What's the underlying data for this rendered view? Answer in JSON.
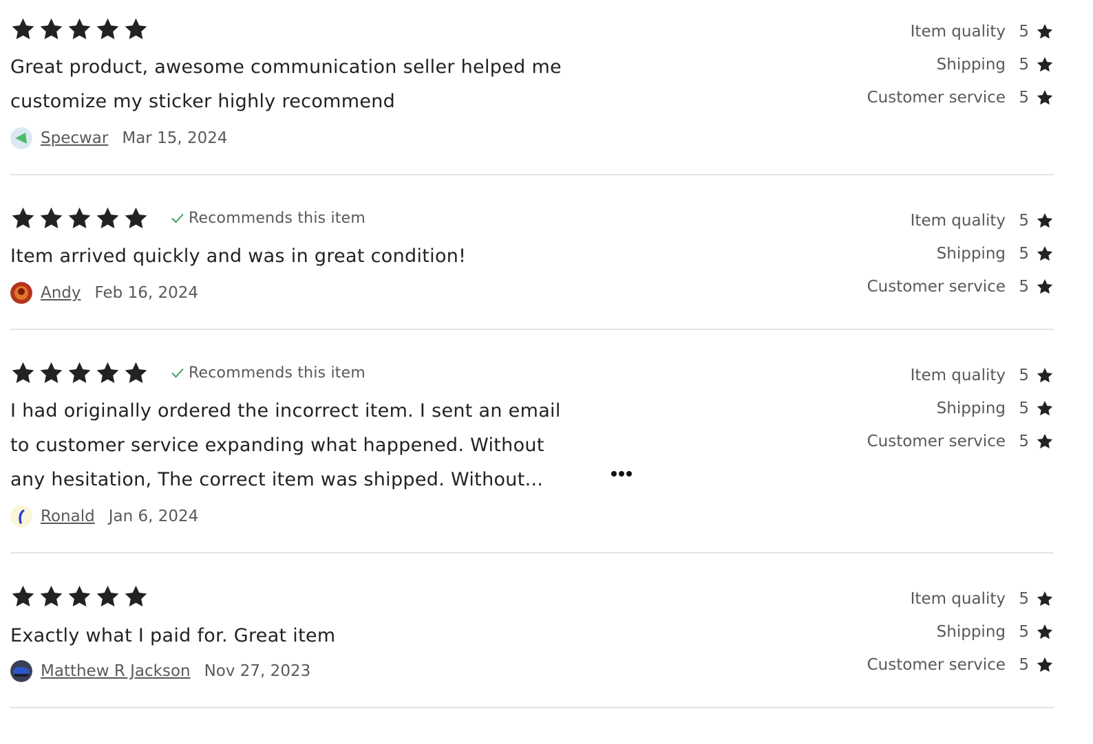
{
  "colors": {
    "star": "#222222",
    "check": "#3ca060",
    "muted_text": "#595959",
    "divider": "#e3e3e3"
  },
  "reviews": [
    {
      "rating": 5,
      "recommends": "",
      "text_lines": [
        "Great product, awesome communication seller helped me",
        "customize my sticker highly recommend"
      ],
      "author": "Specwar",
      "date": "Mar 15, 2024",
      "sub_ratings": [
        {
          "label": "Item quality",
          "value": "5"
        },
        {
          "label": "Shipping",
          "value": "5"
        },
        {
          "label": "Customer service",
          "value": "5"
        }
      ]
    },
    {
      "rating": 5,
      "recommends": "Recommends this item",
      "text_lines": [
        "Item arrived quickly and was in great condition!"
      ],
      "author": "Andy",
      "date": "Feb 16, 2024",
      "sub_ratings": [
        {
          "label": "Item quality",
          "value": "5"
        },
        {
          "label": "Shipping",
          "value": "5"
        },
        {
          "label": "Customer service",
          "value": "5"
        }
      ]
    },
    {
      "rating": 5,
      "recommends": "Recommends this item",
      "text_lines": [
        "I had originally ordered the incorrect item. I sent an email",
        "to customer service expanding what happened. Without",
        "any hesitation, The correct item was shipped. Without..."
      ],
      "author": "Ronald",
      "date": "Jan 6, 2024",
      "sub_ratings": [
        {
          "label": "Item quality",
          "value": "5"
        },
        {
          "label": "Shipping",
          "value": "5"
        },
        {
          "label": "Customer service",
          "value": "5"
        }
      ]
    },
    {
      "rating": 5,
      "recommends": "",
      "text_lines": [
        "Exactly what I paid for. Great item"
      ],
      "author": "Matthew R Jackson",
      "date": "Nov 27, 2023",
      "sub_ratings": [
        {
          "label": "Item quality",
          "value": "5"
        },
        {
          "label": "Shipping",
          "value": "5"
        },
        {
          "label": "Customer service",
          "value": "5"
        }
      ]
    }
  ]
}
